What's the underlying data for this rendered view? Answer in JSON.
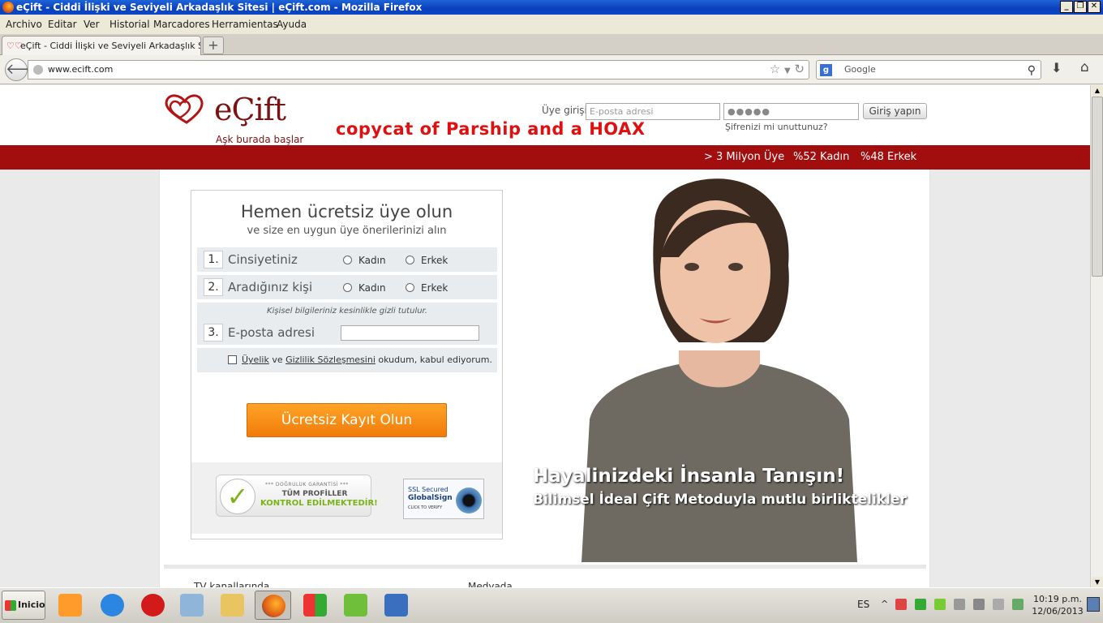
{
  "window": {
    "title": "eÇift - Ciddi İlişki ve Seviyeli Arkadaşlık Sitesi | eÇift.com - Mozilla Firefox"
  },
  "menu": [
    "Archivo",
    "Editar",
    "Ver",
    "Historial",
    "Marcadores",
    "Herramientas",
    "Ayuda"
  ],
  "tab": {
    "title": "eÇift - Ciddi İlişki ve Seviyeli Arkadaşlık Sitesi...",
    "new_tab": "+"
  },
  "nav": {
    "url": "www.ecift.com",
    "search_placeholder": "Google"
  },
  "site": {
    "brand": "eÇift",
    "tagline": "Aşk burada başlar",
    "annotation": "copycat of Parship and a HOAX",
    "login_label": "Üye girişi",
    "email_placeholder": "E-posta adresi",
    "password_value": "●●●●●",
    "login_button": "Giriş yapın",
    "forgot": "Şifrenizi mi unuttunuz?",
    "stats": [
      "> 3 Milyon Üye",
      "%52 Kadın",
      "%48 Erkek"
    ]
  },
  "form": {
    "title": "Hemen ücretsiz üye olun",
    "subtitle": "ve size en uygun üye önerilerinizi alın",
    "q1": {
      "num": "1.",
      "label": "Cinsiyetiniz",
      "opt1": "Kadın",
      "opt2": "Erkek"
    },
    "q2": {
      "num": "2.",
      "label": "Aradığınız kişi",
      "opt1": "Kadın",
      "opt2": "Erkek"
    },
    "privacy": "Kişisel bilgileriniz kesinlikle gizli tutulur.",
    "q3": {
      "num": "3.",
      "label": "E-posta adresi"
    },
    "terms_link1": "Üyelik",
    "terms_and": "ve",
    "terms_link2": "Gizlilik Sözleşmesini",
    "terms_rest": "okudum, kabul ediyorum.",
    "submit": "Ücretsiz Kayıt Olun"
  },
  "badges": {
    "b1_top": "*** DOĞRULUK GARANTİSİ ***",
    "b1_mid": "TÜM PROFİLLER",
    "b1_bot": "KONTROL EDİLMEKTEDİR!",
    "b2_top": "SSL Secured",
    "b2_mid": "GlobalSign",
    "b2_bot": "CLICK TO VERIFY"
  },
  "hero": {
    "headline": "Hayalinizdeki İnsanla Tanışın!",
    "subheadline": "Bilimsel İdeal Çift Metoduyla mutlu birliktelikler"
  },
  "footer": {
    "col1": "TV kanallarında",
    "col2": "Medyada"
  },
  "taskbar": {
    "start": "Inicio",
    "lang": "ES",
    "time": "10:19 p.m.",
    "date": "12/06/2013"
  },
  "colors": {
    "brand_red": "#a20e0e",
    "accent_orange": "#f07c0a",
    "annotation_red": "#e01010"
  }
}
